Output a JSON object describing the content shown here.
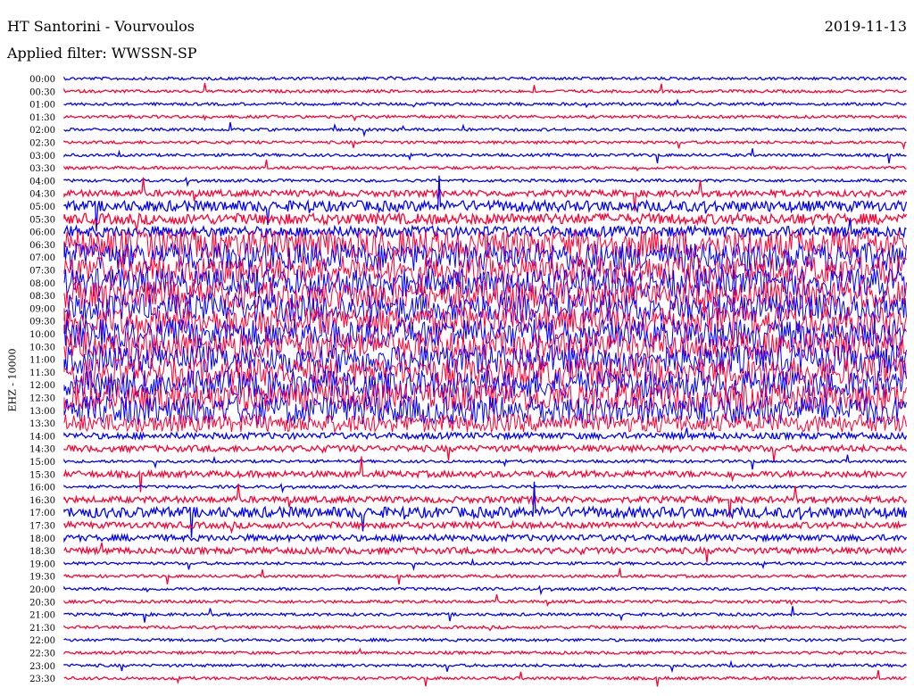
{
  "header": {
    "station_title": "HT Santorini - Vourvoulos",
    "date": "2019-11-13",
    "filter_label": "Applied filter: WWSSN-SP"
  },
  "channel_label": "EHZ - 10000",
  "colors": {
    "trace_a": "#0000ff",
    "trace_b": "#ff0033"
  },
  "chart_data": {
    "type": "line",
    "title": "HT Santorini - Vourvoulos",
    "ylabel": "EHZ - 10000",
    "row_labels": [
      "00:00",
      "00:30",
      "01:00",
      "01:30",
      "02:00",
      "02:30",
      "03:00",
      "03:30",
      "04:00",
      "04:30",
      "05:00",
      "05:30",
      "06:00",
      "06:30",
      "07:00",
      "07:30",
      "08:00",
      "08:30",
      "09:00",
      "09:30",
      "10:00",
      "10:30",
      "11:00",
      "11:30",
      "12:00",
      "12:30",
      "13:00",
      "13:30",
      "14:00",
      "14:30",
      "15:00",
      "15:30",
      "16:00",
      "16:30",
      "17:00",
      "17:30",
      "18:00",
      "18:30",
      "19:00",
      "19:30",
      "20:00",
      "20:30",
      "21:00",
      "21:30",
      "22:00",
      "22:30",
      "23:00",
      "23:30"
    ],
    "row_activity": [
      1,
      1,
      1,
      1,
      1,
      1,
      1,
      1,
      1,
      2,
      3,
      3,
      3,
      5,
      5,
      5,
      5,
      5,
      5,
      5,
      5,
      5,
      5,
      5,
      5,
      5,
      5,
      4,
      2,
      2,
      1,
      2,
      1,
      2,
      3,
      2,
      2,
      2,
      1,
      1,
      1,
      1,
      1,
      1,
      1,
      1,
      1,
      1
    ],
    "series_colors": [
      "#0000ff",
      "#ff0033"
    ]
  }
}
